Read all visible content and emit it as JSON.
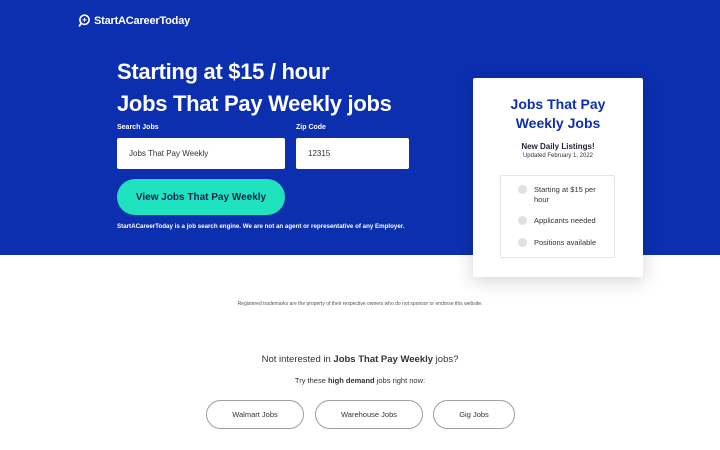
{
  "brand": {
    "name": "StartACareerToday",
    "icon": "search-icon"
  },
  "colors": {
    "hero_bg": "#0b2fae",
    "cta_bg": "#1ee3be",
    "card_title": "#0b2fae"
  },
  "hero": {
    "headline_line1": "Starting at $15 / hour",
    "headline_line2": "Jobs That Pay Weekly jobs",
    "search_label": "Search Jobs",
    "search_value": "Jobs That Pay Weekly",
    "zip_label": "Zip Code",
    "zip_value": "12315",
    "cta_label": "View Jobs That Pay Weekly",
    "disclaimer": "StartACareerToday is a job search engine. We are not an agent or representative of any Employer."
  },
  "card": {
    "title": "Jobs That Pay Weekly Jobs",
    "subtitle": "New Daily Listings!",
    "updated": "Updated February 1, 2022",
    "bullets": [
      "Starting at $15 per hour",
      "Applicants needed",
      "Positions available"
    ]
  },
  "footer": {
    "trademark": "Registered trademarks are the property of their respective owners who do not sponsor or endorse this website.",
    "not_interested_prefix": "Not interested in ",
    "not_interested_job": "Jobs That Pay Weekly",
    "not_interested_suffix": " jobs?",
    "try_prefix": "Try these ",
    "try_highlight": "high demand",
    "try_suffix": " jobs right now:",
    "alternatives": [
      "Walmart Jobs",
      "Warehouse Jobs",
      "Gig Jobs"
    ]
  }
}
